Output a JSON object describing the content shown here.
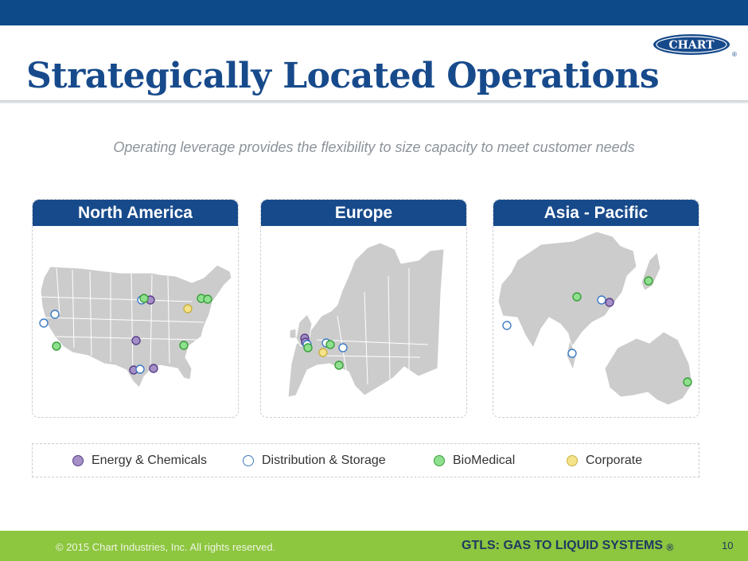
{
  "header": {
    "title": "Strategically Located Operations",
    "logo_text": "CHART",
    "logo_mark": "®"
  },
  "subtitle": "Operating leverage provides the flexibility to size capacity to meet customer needs",
  "regions": [
    {
      "label": "North America"
    },
    {
      "label": "Europe"
    },
    {
      "label": "Asia - Pacific"
    }
  ],
  "legend": [
    {
      "label": "Energy & Chemicals",
      "color": "#a58fc7"
    },
    {
      "label": "Distribution & Storage",
      "color": "#9fc3e7"
    },
    {
      "label": "BioMedical",
      "color": "#8ee08e"
    },
    {
      "label": "Corporate",
      "color": "#f5e38a"
    }
  ],
  "footer": {
    "copyright": "© 2015 Chart Industries, Inc. All rights reserved.",
    "tagline": "GTLS: GAS TO LIQUID SYSTEMS",
    "tagline_mark": "®",
    "page_number": "10"
  },
  "colors": {
    "brand_blue": "#174a8b",
    "footer_green": "#8dc63f",
    "map_fill": "#cccccc"
  }
}
